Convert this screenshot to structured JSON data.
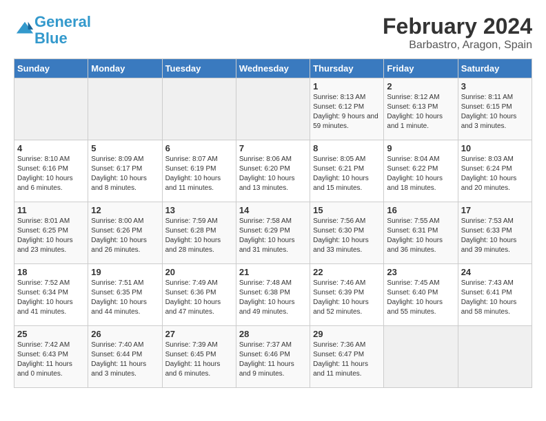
{
  "header": {
    "logo_general": "General",
    "logo_blue": "Blue",
    "main_title": "February 2024",
    "sub_title": "Barbastro, Aragon, Spain"
  },
  "calendar": {
    "days_of_week": [
      "Sunday",
      "Monday",
      "Tuesday",
      "Wednesday",
      "Thursday",
      "Friday",
      "Saturday"
    ],
    "weeks": [
      [
        {
          "day": "",
          "info": ""
        },
        {
          "day": "",
          "info": ""
        },
        {
          "day": "",
          "info": ""
        },
        {
          "day": "",
          "info": ""
        },
        {
          "day": "1",
          "info": "Sunrise: 8:13 AM\nSunset: 6:12 PM\nDaylight: 9 hours and 59 minutes."
        },
        {
          "day": "2",
          "info": "Sunrise: 8:12 AM\nSunset: 6:13 PM\nDaylight: 10 hours and 1 minute."
        },
        {
          "day": "3",
          "info": "Sunrise: 8:11 AM\nSunset: 6:15 PM\nDaylight: 10 hours and 3 minutes."
        }
      ],
      [
        {
          "day": "4",
          "info": "Sunrise: 8:10 AM\nSunset: 6:16 PM\nDaylight: 10 hours and 6 minutes."
        },
        {
          "day": "5",
          "info": "Sunrise: 8:09 AM\nSunset: 6:17 PM\nDaylight: 10 hours and 8 minutes."
        },
        {
          "day": "6",
          "info": "Sunrise: 8:07 AM\nSunset: 6:19 PM\nDaylight: 10 hours and 11 minutes."
        },
        {
          "day": "7",
          "info": "Sunrise: 8:06 AM\nSunset: 6:20 PM\nDaylight: 10 hours and 13 minutes."
        },
        {
          "day": "8",
          "info": "Sunrise: 8:05 AM\nSunset: 6:21 PM\nDaylight: 10 hours and 15 minutes."
        },
        {
          "day": "9",
          "info": "Sunrise: 8:04 AM\nSunset: 6:22 PM\nDaylight: 10 hours and 18 minutes."
        },
        {
          "day": "10",
          "info": "Sunrise: 8:03 AM\nSunset: 6:24 PM\nDaylight: 10 hours and 20 minutes."
        }
      ],
      [
        {
          "day": "11",
          "info": "Sunrise: 8:01 AM\nSunset: 6:25 PM\nDaylight: 10 hours and 23 minutes."
        },
        {
          "day": "12",
          "info": "Sunrise: 8:00 AM\nSunset: 6:26 PM\nDaylight: 10 hours and 26 minutes."
        },
        {
          "day": "13",
          "info": "Sunrise: 7:59 AM\nSunset: 6:28 PM\nDaylight: 10 hours and 28 minutes."
        },
        {
          "day": "14",
          "info": "Sunrise: 7:58 AM\nSunset: 6:29 PM\nDaylight: 10 hours and 31 minutes."
        },
        {
          "day": "15",
          "info": "Sunrise: 7:56 AM\nSunset: 6:30 PM\nDaylight: 10 hours and 33 minutes."
        },
        {
          "day": "16",
          "info": "Sunrise: 7:55 AM\nSunset: 6:31 PM\nDaylight: 10 hours and 36 minutes."
        },
        {
          "day": "17",
          "info": "Sunrise: 7:53 AM\nSunset: 6:33 PM\nDaylight: 10 hours and 39 minutes."
        }
      ],
      [
        {
          "day": "18",
          "info": "Sunrise: 7:52 AM\nSunset: 6:34 PM\nDaylight: 10 hours and 41 minutes."
        },
        {
          "day": "19",
          "info": "Sunrise: 7:51 AM\nSunset: 6:35 PM\nDaylight: 10 hours and 44 minutes."
        },
        {
          "day": "20",
          "info": "Sunrise: 7:49 AM\nSunset: 6:36 PM\nDaylight: 10 hours and 47 minutes."
        },
        {
          "day": "21",
          "info": "Sunrise: 7:48 AM\nSunset: 6:38 PM\nDaylight: 10 hours and 49 minutes."
        },
        {
          "day": "22",
          "info": "Sunrise: 7:46 AM\nSunset: 6:39 PM\nDaylight: 10 hours and 52 minutes."
        },
        {
          "day": "23",
          "info": "Sunrise: 7:45 AM\nSunset: 6:40 PM\nDaylight: 10 hours and 55 minutes."
        },
        {
          "day": "24",
          "info": "Sunrise: 7:43 AM\nSunset: 6:41 PM\nDaylight: 10 hours and 58 minutes."
        }
      ],
      [
        {
          "day": "25",
          "info": "Sunrise: 7:42 AM\nSunset: 6:43 PM\nDaylight: 11 hours and 0 minutes."
        },
        {
          "day": "26",
          "info": "Sunrise: 7:40 AM\nSunset: 6:44 PM\nDaylight: 11 hours and 3 minutes."
        },
        {
          "day": "27",
          "info": "Sunrise: 7:39 AM\nSunset: 6:45 PM\nDaylight: 11 hours and 6 minutes."
        },
        {
          "day": "28",
          "info": "Sunrise: 7:37 AM\nSunset: 6:46 PM\nDaylight: 11 hours and 9 minutes."
        },
        {
          "day": "29",
          "info": "Sunrise: 7:36 AM\nSunset: 6:47 PM\nDaylight: 11 hours and 11 minutes."
        },
        {
          "day": "",
          "info": ""
        },
        {
          "day": "",
          "info": ""
        }
      ]
    ]
  }
}
